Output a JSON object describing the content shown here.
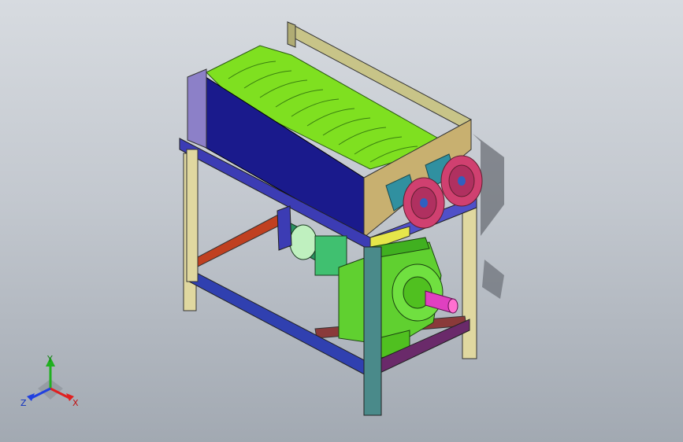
{
  "triad": {
    "x_label": "X",
    "y_label": "Y",
    "z_label": "Z",
    "x_color": "#e02020",
    "y_color": "#20b020",
    "z_color": "#2040e0"
  },
  "colors": {
    "background_top": "#d7dbe0",
    "background_bottom": "#a2a9b2",
    "hopper_body": "#1a1a8c",
    "hopper_side": "#c8c488",
    "blades": "#7fe020",
    "frame_top": "#3c3cb4",
    "leg": "#e0d8a0",
    "rail_front": "#3040b0",
    "rail_back": "#c04020",
    "motor_body": "#40c070",
    "gearbox": "#60d030",
    "shaft": "#e040c0",
    "pulley": "#d04070",
    "bearing": "#3090a0"
  }
}
